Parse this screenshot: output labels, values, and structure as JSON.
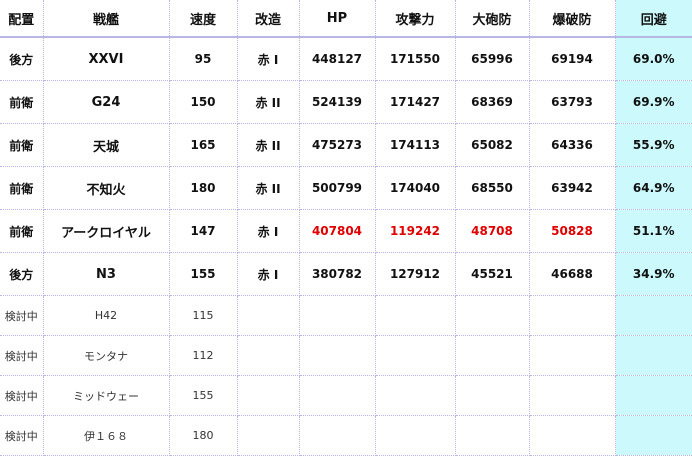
{
  "headers": [
    "配置",
    "戦艦",
    "速度",
    "改造",
    "HP",
    "攻撃力",
    "大砲防",
    "爆破防",
    "回避"
  ],
  "colors": {
    "evade_bg": "#ccf9fb",
    "highlight_red": "#e00000",
    "grid": "#b7b7e6"
  },
  "rows": [
    {
      "pos": "後方",
      "name": "XXVI",
      "speed": "95",
      "mod": "赤 I",
      "hp": "448127",
      "atk": "171550",
      "gun_def": "65996",
      "blast_def": "69194",
      "evade": "69.0%",
      "highlight": false
    },
    {
      "pos": "前衛",
      "name": "G24",
      "speed": "150",
      "mod": "赤 II",
      "hp": "524139",
      "atk": "171427",
      "gun_def": "68369",
      "blast_def": "63793",
      "evade": "69.9%",
      "highlight": false
    },
    {
      "pos": "前衛",
      "name": "天城",
      "speed": "165",
      "mod": "赤 II",
      "hp": "475273",
      "atk": "174113",
      "gun_def": "65082",
      "blast_def": "64336",
      "evade": "55.9%",
      "highlight": false
    },
    {
      "pos": "前衛",
      "name": "不知火",
      "speed": "180",
      "mod": "赤 II",
      "hp": "500799",
      "atk": "174040",
      "gun_def": "68550",
      "blast_def": "63942",
      "evade": "64.9%",
      "highlight": false
    },
    {
      "pos": "前衛",
      "name": "アークロイヤル",
      "speed": "147",
      "mod": "赤 I",
      "hp": "407804",
      "atk": "119242",
      "gun_def": "48708",
      "blast_def": "50828",
      "evade": "51.1%",
      "highlight": true
    },
    {
      "pos": "後方",
      "name": "N3",
      "speed": "155",
      "mod": "赤 I",
      "hp": "380782",
      "atk": "127912",
      "gun_def": "45521",
      "blast_def": "46688",
      "evade": "34.9%",
      "highlight": false
    }
  ],
  "candidates": [
    {
      "pos": "検討中",
      "name": "H42",
      "speed": "115"
    },
    {
      "pos": "検討中",
      "name": "モンタナ",
      "speed": "112"
    },
    {
      "pos": "検討中",
      "name": "ミッドウェー",
      "speed": "155"
    },
    {
      "pos": "検討中",
      "name": "伊１６８",
      "speed": "180"
    }
  ]
}
